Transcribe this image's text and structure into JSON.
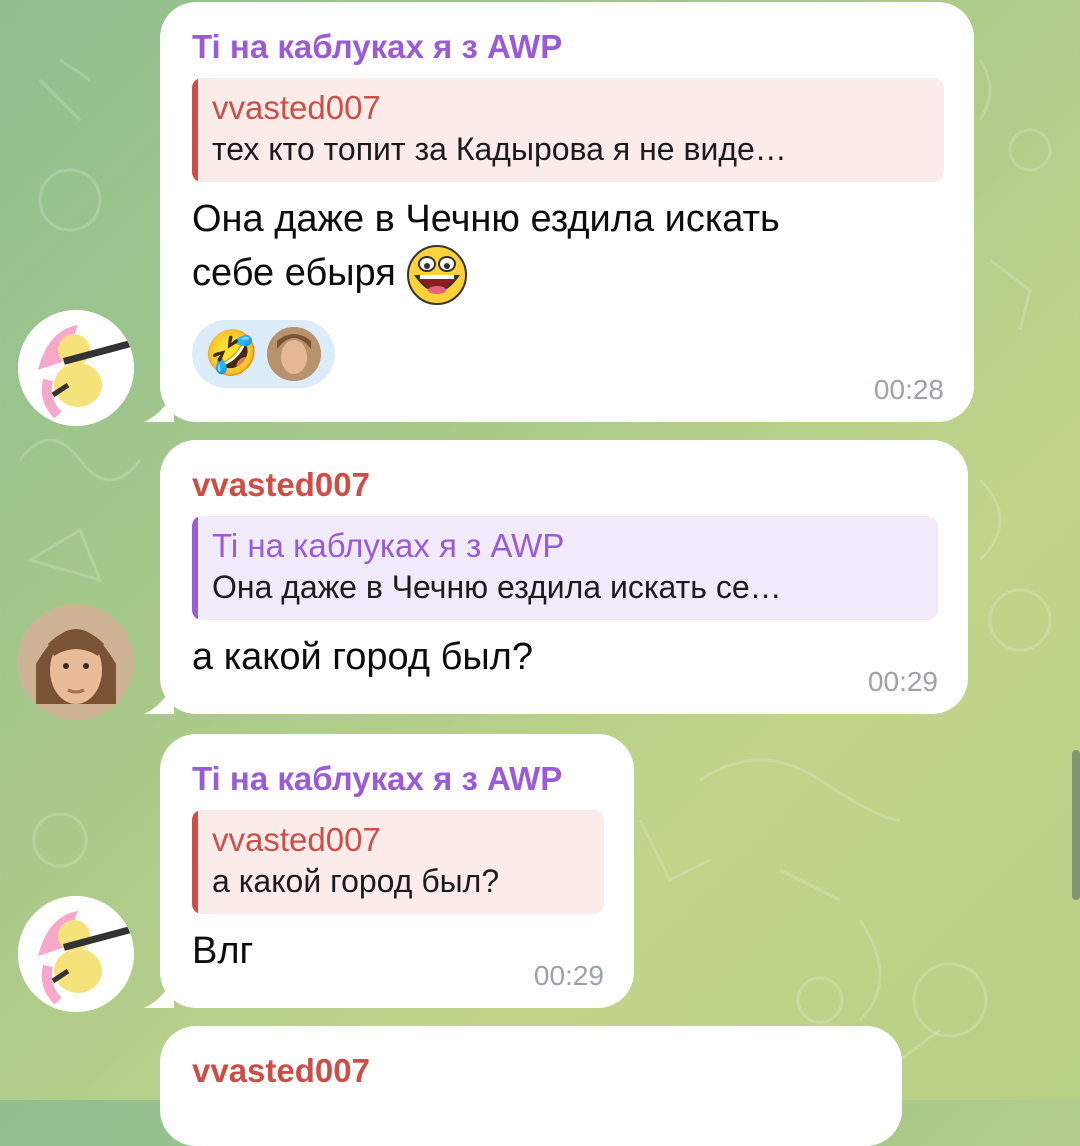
{
  "colors": {
    "purple_sender": "#9a5bd6",
    "red_sender": "#cd4e47",
    "time": "#9aa3a8",
    "reaction_bg": "#dcecf8"
  },
  "messages": [
    {
      "sender": "Ti на каблуках я з AWP",
      "reply_name": "vvasted007",
      "reply_text": "тех кто топит за Кадырова я не виде…",
      "text_line1": "Она даже в Чечню ездила искать",
      "text_line2": "себе ебыря",
      "inline_emoji": "awesome-face-emoji",
      "reaction": "🤣",
      "time": "00:28"
    },
    {
      "sender": "vvasted007",
      "reply_name": "Ti на каблуках я з AWP",
      "reply_text": "Она даже в Чечню ездила искать се…",
      "text": "а какой город был?",
      "time": "00:29"
    },
    {
      "sender": "Ti на каблуках я з AWP",
      "reply_name": "vvasted007",
      "reply_text": "а какой город был?",
      "text": "Влг",
      "time": "00:29"
    },
    {
      "sender": "vvasted007"
    }
  ]
}
